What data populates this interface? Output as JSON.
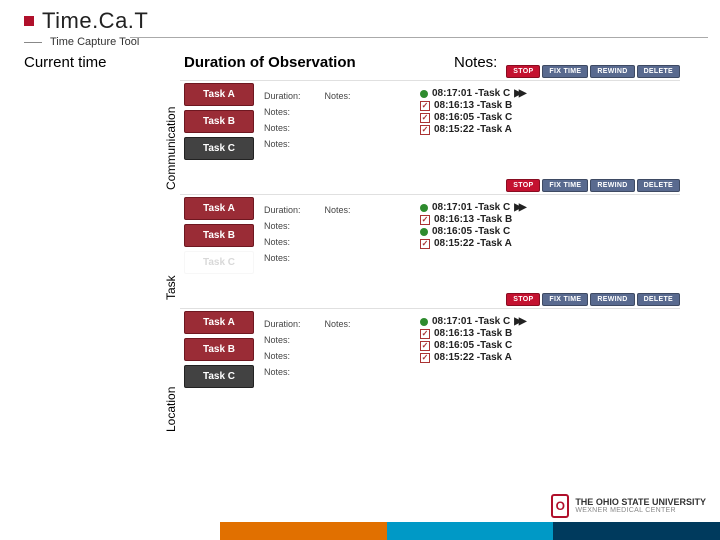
{
  "header": {
    "title": "Time.Ca.T",
    "subtitle": "Time Capture Tool"
  },
  "labels": {
    "current_time": "Current time",
    "duration": "Duration of Observation",
    "notes": "Notes:"
  },
  "categories": [
    "Communication",
    "Task",
    "Location"
  ],
  "action_labels": {
    "stop": "STOP",
    "fix": "FIX TIME",
    "rewind": "REWIND",
    "delete": "DELETE"
  },
  "field_labels": {
    "duration": "Duration:",
    "notes": "Notes:"
  },
  "panels": [
    {
      "category": "Communication",
      "tasks": [
        {
          "label": "Task A",
          "style": "normal"
        },
        {
          "label": "Task B",
          "style": "normal"
        },
        {
          "label": "Task C",
          "style": "sel"
        }
      ],
      "log": [
        {
          "icon": "dot",
          "text": "08:17:01 -Task C",
          "play": true
        },
        {
          "icon": "chk",
          "text": "08:16:13 -Task B"
        },
        {
          "icon": "chk",
          "text": "08:16:05 -Task C"
        },
        {
          "icon": "chk",
          "text": "08:15:22 -Task A"
        }
      ]
    },
    {
      "category": "Task",
      "tasks": [
        {
          "label": "Task A",
          "style": "normal"
        },
        {
          "label": "Task B",
          "style": "normal"
        },
        {
          "label": "Task C",
          "style": "ghost"
        }
      ],
      "log": [
        {
          "icon": "dot",
          "text": "08:17:01 -Task C",
          "play": true
        },
        {
          "icon": "chk",
          "text": "08:16:13 -Task B"
        },
        {
          "icon": "dot",
          "text": "08:16:05 -Task C"
        },
        {
          "icon": "chk",
          "text": "08:15:22 -Task A"
        }
      ]
    },
    {
      "category": "Location",
      "tasks": [
        {
          "label": "Task A",
          "style": "normal"
        },
        {
          "label": "Task B",
          "style": "normal"
        },
        {
          "label": "Task C",
          "style": "sel"
        }
      ],
      "log": [
        {
          "icon": "dot",
          "text": "08:17:01 -Task C",
          "play": true
        },
        {
          "icon": "chk",
          "text": "08:16:13 -Task B"
        },
        {
          "icon": "chk",
          "text": "08:16:05 -Task C"
        },
        {
          "icon": "chk",
          "text": "08:15:22 -Task A"
        }
      ]
    }
  ],
  "footer": {
    "org_line1": "THE OHIO STATE UNIVERSITY",
    "org_line2": "WEXNER MEDICAL CENTER",
    "mark": "O"
  }
}
